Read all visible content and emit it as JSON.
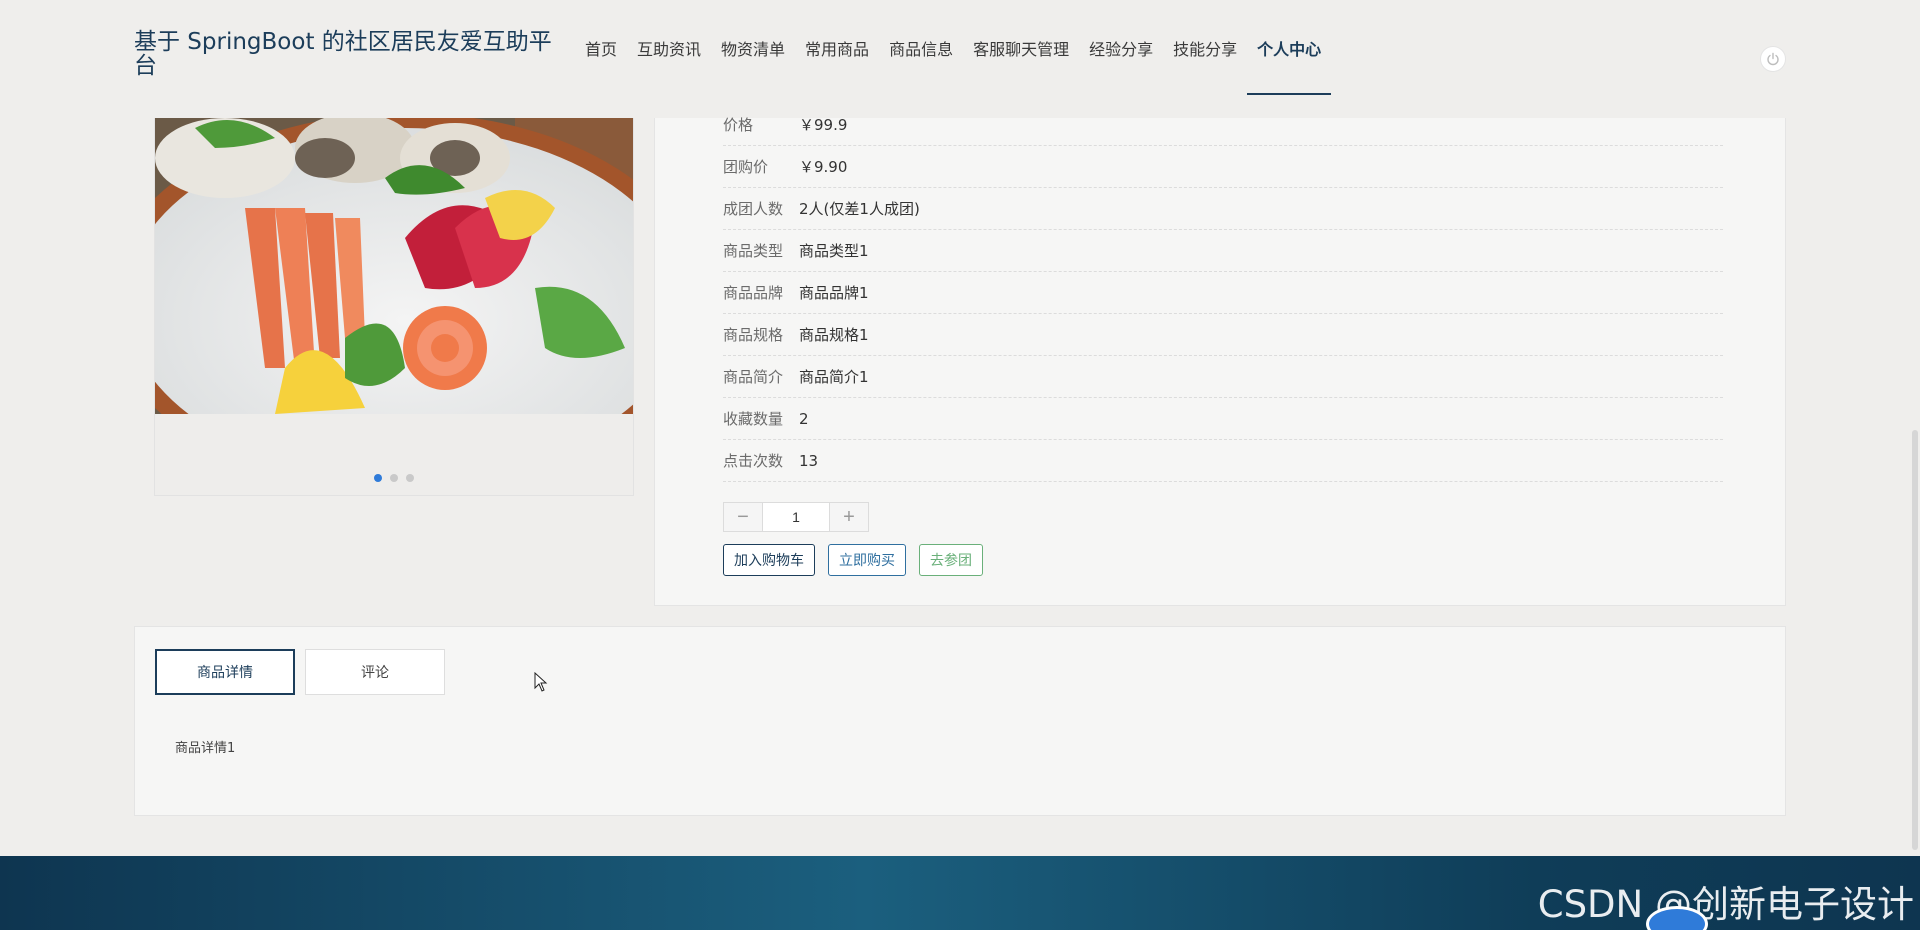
{
  "header": {
    "site_title": "基于 SpringBoot 的社区居民友爱互助平台",
    "nav": [
      {
        "label": "首页"
      },
      {
        "label": "互助资讯"
      },
      {
        "label": "物资清单"
      },
      {
        "label": "常用商品"
      },
      {
        "label": "商品信息"
      },
      {
        "label": "客服聊天管理"
      },
      {
        "label": "经验分享"
      },
      {
        "label": "技能分享"
      },
      {
        "label": "个人中心"
      }
    ],
    "active_nav": "个人中心",
    "logout_icon": "power-icon"
  },
  "gallery": {
    "slide_count": 3,
    "active_slide": 1
  },
  "product": {
    "fields": [
      {
        "label": "价格",
        "value": "￥99.9"
      },
      {
        "label": "团购价",
        "value": "￥9.90"
      },
      {
        "label": "成团人数",
        "value": "2人(仅差1人成团)"
      },
      {
        "label": "商品类型",
        "value": "商品类型1"
      },
      {
        "label": "商品品牌",
        "value": "商品品牌1"
      },
      {
        "label": "商品规格",
        "value": "商品规格1"
      },
      {
        "label": "商品简介",
        "value": "商品简介1"
      },
      {
        "label": "收藏数量",
        "value": "2"
      },
      {
        "label": "点击次数",
        "value": "13"
      }
    ],
    "quantity": "1",
    "stepper_minus": "−",
    "stepper_plus": "+",
    "buttons": {
      "add_to_cart": "加入购物车",
      "buy_now": "立即购买",
      "join_group": "去参团"
    }
  },
  "detail": {
    "tabs": [
      {
        "label": "商品详情"
      },
      {
        "label": "评论"
      }
    ],
    "active_tab": "商品详情",
    "content": "商品详情1"
  },
  "footer": {
    "watermark": "CSDN @创新电子设计"
  },
  "colors": {
    "primary": "#1c3d5a",
    "page_bg": "#efeeec",
    "active_dot": "#2f7bd9",
    "group_btn": "#6ab07a"
  }
}
